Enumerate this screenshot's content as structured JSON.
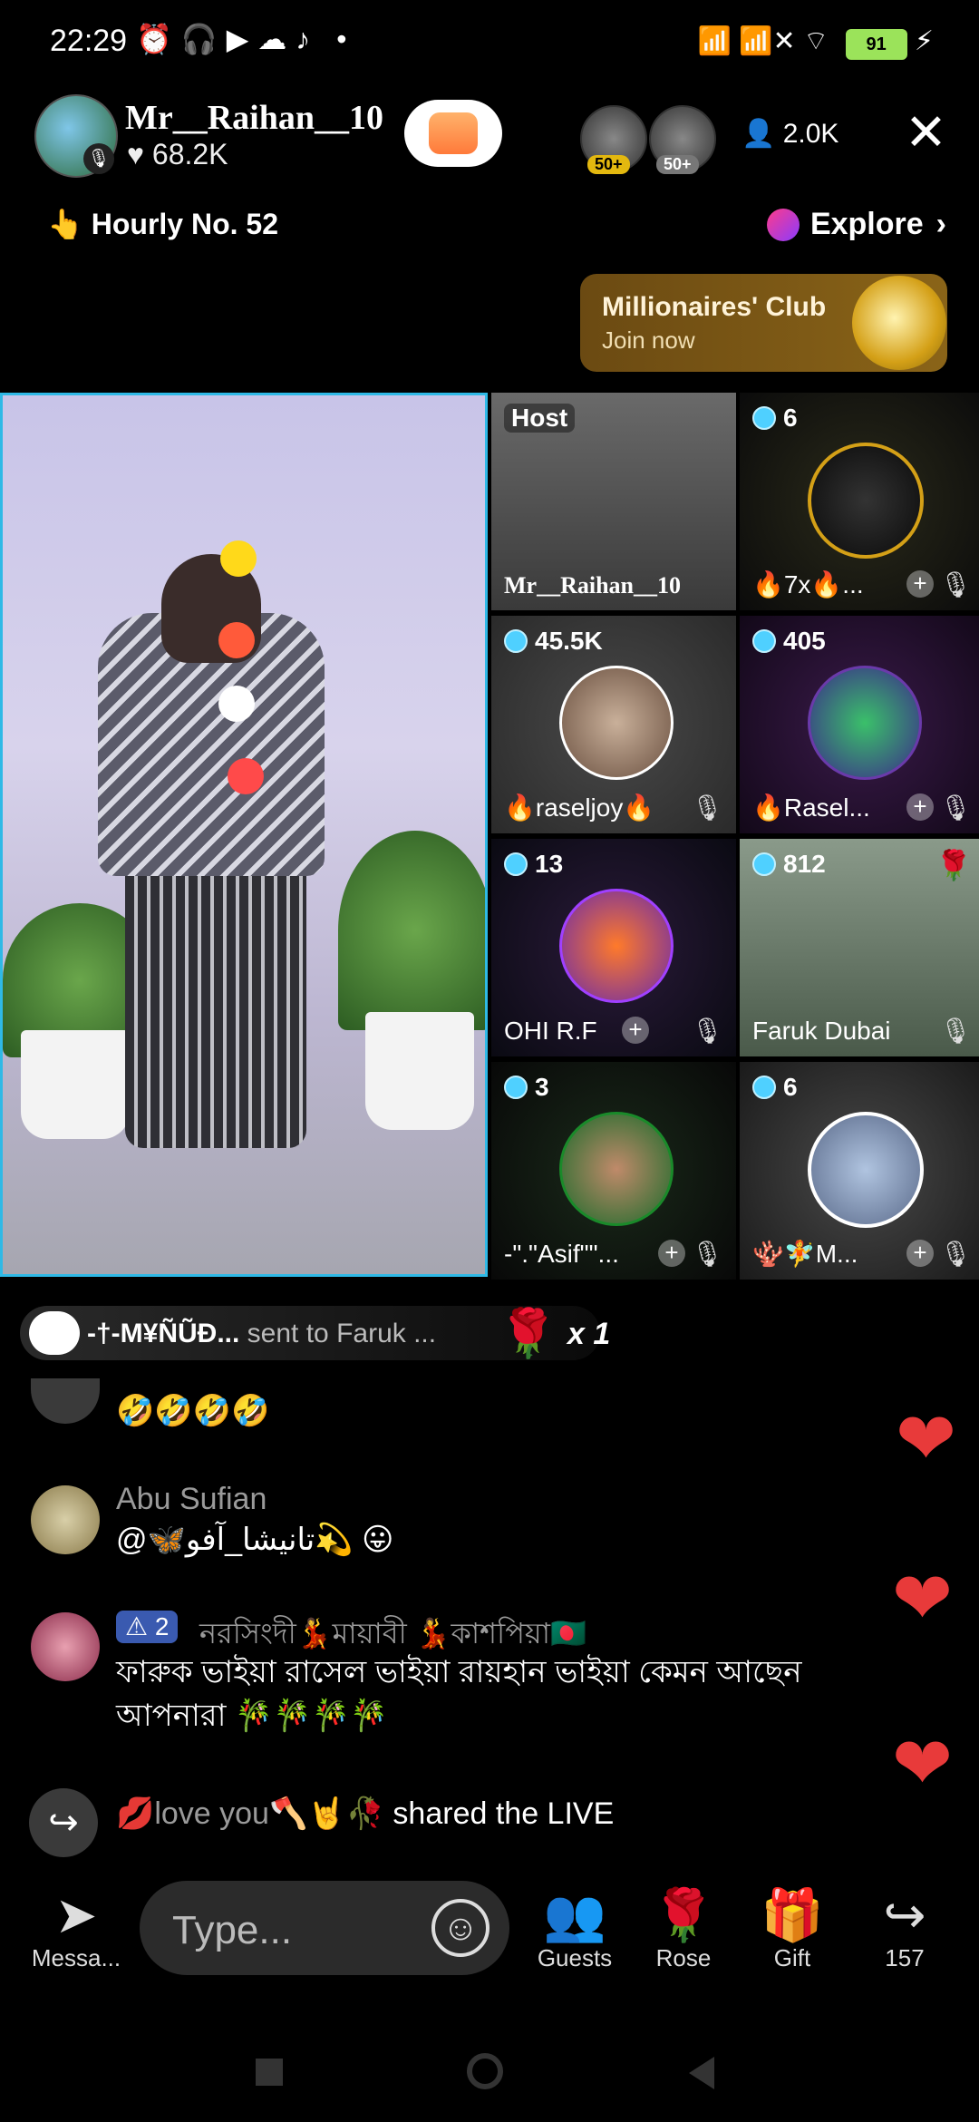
{
  "status": {
    "time": "22:29",
    "icons": "⏰🎧▶☁♪ •",
    "signal": "📶 📶✕",
    "battery": "91"
  },
  "header": {
    "host_name": "Mr__Raihan__10",
    "likes": "♥ 68.2K",
    "viewer1_badge": "50+",
    "viewer2_badge": "50+",
    "viewer_count": "👤 2.0K",
    "close_label": "✕"
  },
  "ranking": {
    "hourly": "👆 Hourly No. 52",
    "explore": "Explore",
    "explore_arrow": "›"
  },
  "club": {
    "title": "Millionaires' Club",
    "subtitle": "Join now"
  },
  "tiles": [
    {
      "badge": "Host",
      "name": "Mr__Raihan__10"
    },
    {
      "badge": "6",
      "name": "🔥7x🔥..."
    },
    {
      "badge": "45.5K",
      "name": "🔥raseljoy🔥"
    },
    {
      "badge": "405",
      "name": "🔥Rasel..."
    },
    {
      "badge": "13",
      "name": "OHI R.F"
    },
    {
      "badge": "812",
      "name": "Faruk Dubai"
    },
    {
      "badge": "3",
      "name": "-\".\"Asif\"\"..."
    },
    {
      "badge": "6",
      "name": "🪸🧚M..."
    }
  ],
  "gift_banner": {
    "sender": "-†-M¥ÑŨÐ...",
    "text": " sent to Faruk ...",
    "rose": "🌹",
    "count": "x 1"
  },
  "chat": [
    {
      "name": "",
      "text": "🤣🤣🤣🤣"
    },
    {
      "name": "Abu Sufian",
      "text": "@🦋تانیشا_آفو💫 😛"
    },
    {
      "name": "নরসিংদী💃মায়াবী 💃কাশপিয়া🇧🇩",
      "level": "⚠ 2",
      "text": "ফারুক ভাইয়া রাসেল ভাইয়া রায়হান ভাইয়া কেমন আছেন আপনারা 🎋🎋🎋🎋"
    }
  ],
  "share_notice": {
    "user": "💋love you🪓🤘🥀",
    "text": " shared the LIVE"
  },
  "bottom_bar": {
    "message": "Messa...",
    "type_placeholder": "Type...",
    "guests": "Guests",
    "rose": "Rose",
    "gift": "Gift",
    "share_count": "157"
  },
  "colors": {
    "accent_blue": "#2fb9e6",
    "heart_red": "#e83a3a",
    "club_gold": "#8a6418"
  }
}
